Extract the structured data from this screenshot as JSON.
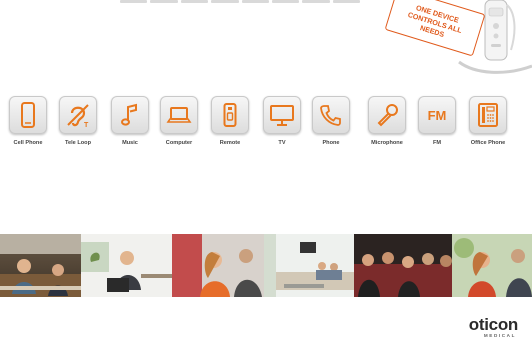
{
  "callout": {
    "line1": "ONE DEVICE",
    "line2": "CONTROLS ALL",
    "line3": "NEEDS",
    "color": "#e05a1c"
  },
  "icons": [
    {
      "label": "Cell Phone",
      "icon": "cell-phone-icon"
    },
    {
      "label": "Tele Loop",
      "icon": "tele-loop-icon"
    },
    {
      "label": "Music",
      "icon": "music-note-icon"
    },
    {
      "label": "Computer",
      "icon": "laptop-icon"
    },
    {
      "label": "Remote",
      "icon": "remote-icon"
    },
    {
      "label": "TV",
      "icon": "tv-icon"
    },
    {
      "label": "Phone",
      "icon": "phone-handset-icon"
    },
    {
      "label": "Microphone",
      "icon": "microphone-icon"
    },
    {
      "label": "FM",
      "icon": "fm-icon",
      "glyph": "FM"
    },
    {
      "label": "Office Phone",
      "icon": "office-phone-icon"
    }
  ],
  "logo": {
    "main": "oticon",
    "sub": "MEDICAL"
  },
  "accent_color": "#e8781e"
}
